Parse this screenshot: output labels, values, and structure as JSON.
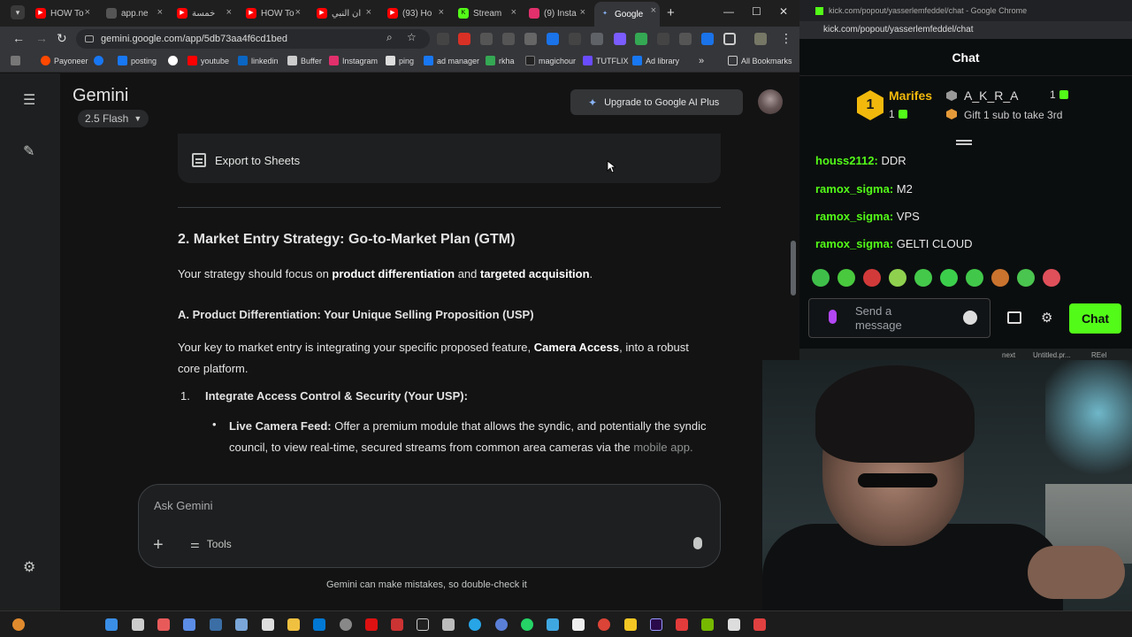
{
  "browser_left": {
    "tabs": [
      {
        "label": "HOW To",
        "color": "#ff0000"
      },
      {
        "label": "app.ne",
        "color": "#666666"
      },
      {
        "label": "خمسة",
        "color": "#ff0000"
      },
      {
        "label": "HOW To",
        "color": "#ff0000"
      },
      {
        "label": "ان النبي",
        "color": "#ff0000"
      },
      {
        "label": "(93) Ho",
        "color": "#ff0000"
      },
      {
        "label": "Stream",
        "color": "#53fc18"
      },
      {
        "label": "(9) Insta",
        "color": "#e1306c"
      },
      {
        "label": "Google",
        "color": "#8ab4f8"
      }
    ],
    "url": "gemini.google.com/app/5db73aa4f6cd1bed",
    "bookmarks": [
      {
        "label": "Payoneer",
        "color": "#ff4800"
      },
      {
        "label": "",
        "color": "#1877f2"
      },
      {
        "label": "posting",
        "color": "#1877f2"
      },
      {
        "label": "",
        "color": "#ffffff"
      },
      {
        "label": "youtube",
        "color": "#ff0000"
      },
      {
        "label": "linkedin",
        "color": "#0a66c2"
      },
      {
        "label": "Buffer",
        "color": "#cccccc"
      },
      {
        "label": "Instagram",
        "color": "#e1306c"
      },
      {
        "label": "ping",
        "color": "#dddddd"
      },
      {
        "label": "ad manager",
        "color": "#1877f2"
      },
      {
        "label": "rkha",
        "color": "#34a853"
      },
      {
        "label": "magichour",
        "color": "#222222"
      },
      {
        "label": "TUTFLIX",
        "color": "#6a4cff"
      },
      {
        "label": "Ad library",
        "color": "#1877f2"
      }
    ],
    "all_bookmarks": "All Bookmarks"
  },
  "gemini": {
    "title": "Gemini",
    "model": "2.5 Flash",
    "upgrade_label": "Upgrade to Google AI Plus",
    "export_label": "Export to Sheets",
    "heading": "2. Market Entry Strategy: Go-to-Market Plan (GTM)",
    "para1_a": "Your strategy should focus on ",
    "para1_b": "product differentiation",
    "para1_c": " and ",
    "para1_d": "targeted acquisition",
    "para1_e": ".",
    "subheading": "A. Product Differentiation: Your Unique Selling Proposition (USP)",
    "para2_a": "Your key to market entry is integrating your specific proposed feature, ",
    "para2_b": "Camera Access",
    "para2_c": ", into a robust core platform.",
    "list_num": "1.",
    "list_item": "Integrate Access Control & Security (Your USP):",
    "bullet_title": "Live Camera Feed:",
    "bullet_text": " Offer a premium module that allows the syndic, and potentially the syndic council, to view real-time, secured streams from common area cameras via the ",
    "bullet_fade": "mobile app.",
    "ask_placeholder": "Ask Gemini",
    "tools_label": "Tools",
    "disclaimer": "Gemini can make mistakes, so double-check it"
  },
  "kick": {
    "window_title": "kick.com/popout/yasserlemfeddel/chat - Google Chrome",
    "url": "kick.com/popout/yasserlemfeddel/chat",
    "header": "Chat",
    "top1_rank": "1",
    "top1_name": "Marifes",
    "top1_count": "1",
    "top2_name": "A_K_R_A",
    "top2_count": "1",
    "gift_text": "Gift 1 sub to take 3rd",
    "messages": [
      {
        "user": "houss2112:",
        "text": " DDR"
      },
      {
        "user": "ramox_sigma:",
        "text": " M2"
      },
      {
        "user": "ramox_sigma:",
        "text": " VPS"
      },
      {
        "user": "ramox_sigma:",
        "text": " GELTI CLOUD"
      }
    ],
    "emote_colors": [
      "#3fbf4a",
      "#49c93e",
      "#d23a3a",
      "#8fd14f",
      "#44c94a",
      "#3ccf4c",
      "#41c84a",
      "#c9732e",
      "#4ac54f",
      "#e0505a"
    ],
    "send_placeholder": "Send a message",
    "chat_button": "Chat",
    "footer_next": "next",
    "footer_untitled": "Untitled.pr...",
    "footer_reel": "REel"
  },
  "colors": {
    "kick_green": "#53fc18",
    "gemini_bg": "#131314"
  }
}
